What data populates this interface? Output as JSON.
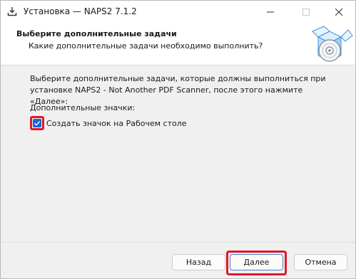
{
  "window": {
    "title": "Установка — NAPS2 7.1.2",
    "icons": {
      "app": "installer-download-icon",
      "minimize": "minimize-icon",
      "maximize": "maximize-icon",
      "close": "close-icon"
    }
  },
  "header": {
    "title": "Выберите дополнительные задачи",
    "subtitle": "Какие дополнительные задачи необходимо выполнить?",
    "art": "software-box-disc-icon"
  },
  "content": {
    "description": "Выберите дополнительные задачи, которые должны выполниться при установке NAPS2 - Not Another PDF Scanner, после этого нажмите «Далее»:",
    "section_label": "Дополнительные значки:",
    "tasks": [
      {
        "label": "Создать значок на Рабочем столе",
        "checked": true
      }
    ]
  },
  "buttons": {
    "back": "Назад",
    "next": "Далее",
    "cancel": "Отмена"
  },
  "colors": {
    "highlight": "#e0182b",
    "checkbox": "#1369d2",
    "accent_border": "#4a7ec4"
  }
}
